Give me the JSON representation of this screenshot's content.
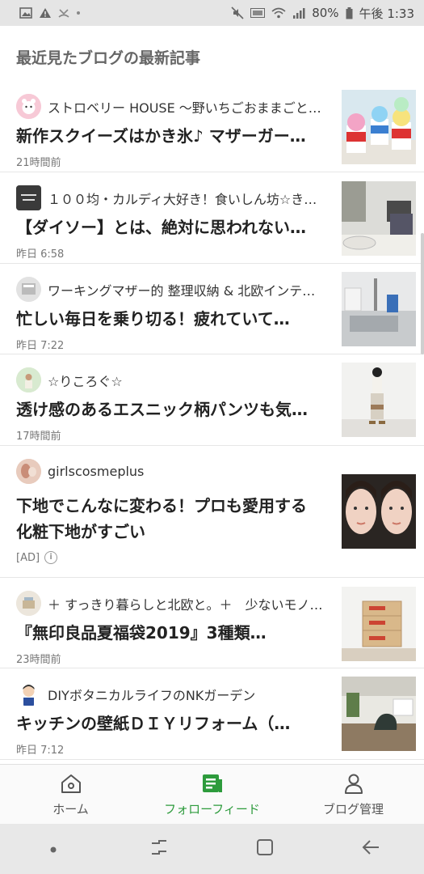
{
  "status_bar": {
    "battery_percent": "80%",
    "time": "午後 1:33",
    "icons": [
      "image-icon",
      "warning-icon",
      "missed-call-icon",
      "dot-icon",
      "mute-icon",
      "volte-icon",
      "wifi-icon",
      "signal-icon",
      "battery-icon"
    ]
  },
  "header": {
    "title": "最近見たブログの最新記事"
  },
  "posts": [
    {
      "blog": "ストロベリー HOUSE 〜野いちごおままごと…",
      "title": "新作スクイーズはかき氷♪ マザーガー…",
      "time": "21時間前"
    },
    {
      "blog": "１００均・カルディ大好き！食いしん坊☆きら…",
      "title": "【ダイソー】とは、絶対に思われない…",
      "time": "昨日 6:58"
    },
    {
      "blog": "ワーキングマザー的 整理収納 & 北欧インテリア",
      "title": "忙しい毎日を乗り切る！疲れていて…",
      "time": "昨日 7:22"
    },
    {
      "blog": "☆りころぐ☆",
      "title": "透け感のあるエスニック柄パンツも気…",
      "time": "17時間前"
    }
  ],
  "ad": {
    "blog": "girlscosmeplus",
    "title": "下地でこんなに変わる！プロも愛用する化粧下地がすごい",
    "badge": "[AD]",
    "info_icon": "i"
  },
  "posts2": [
    {
      "blog": "＋ すっきり暮らしと北欧と。＋　少ないモノ…",
      "title": "『無印良品夏福袋2019』3種類…",
      "time": "23時間前"
    },
    {
      "blog": "DIYボタニカルライフのNKガーデン",
      "title": "キッチンの壁紙ＤＩＹリフォーム（…",
      "time": "昨日 7:12"
    }
  ],
  "tabs": [
    {
      "label": "ホーム",
      "icon": "home-icon",
      "active": false
    },
    {
      "label": "フォローフィード",
      "icon": "feed-icon",
      "active": true
    },
    {
      "label": "ブログ管理",
      "icon": "person-icon",
      "active": false
    }
  ],
  "colors": {
    "accent": "#2d9b3c",
    "divider": "#e6e6e6",
    "status_bar": "#e5e5e5",
    "nav_bar": "#e8e8e8"
  }
}
